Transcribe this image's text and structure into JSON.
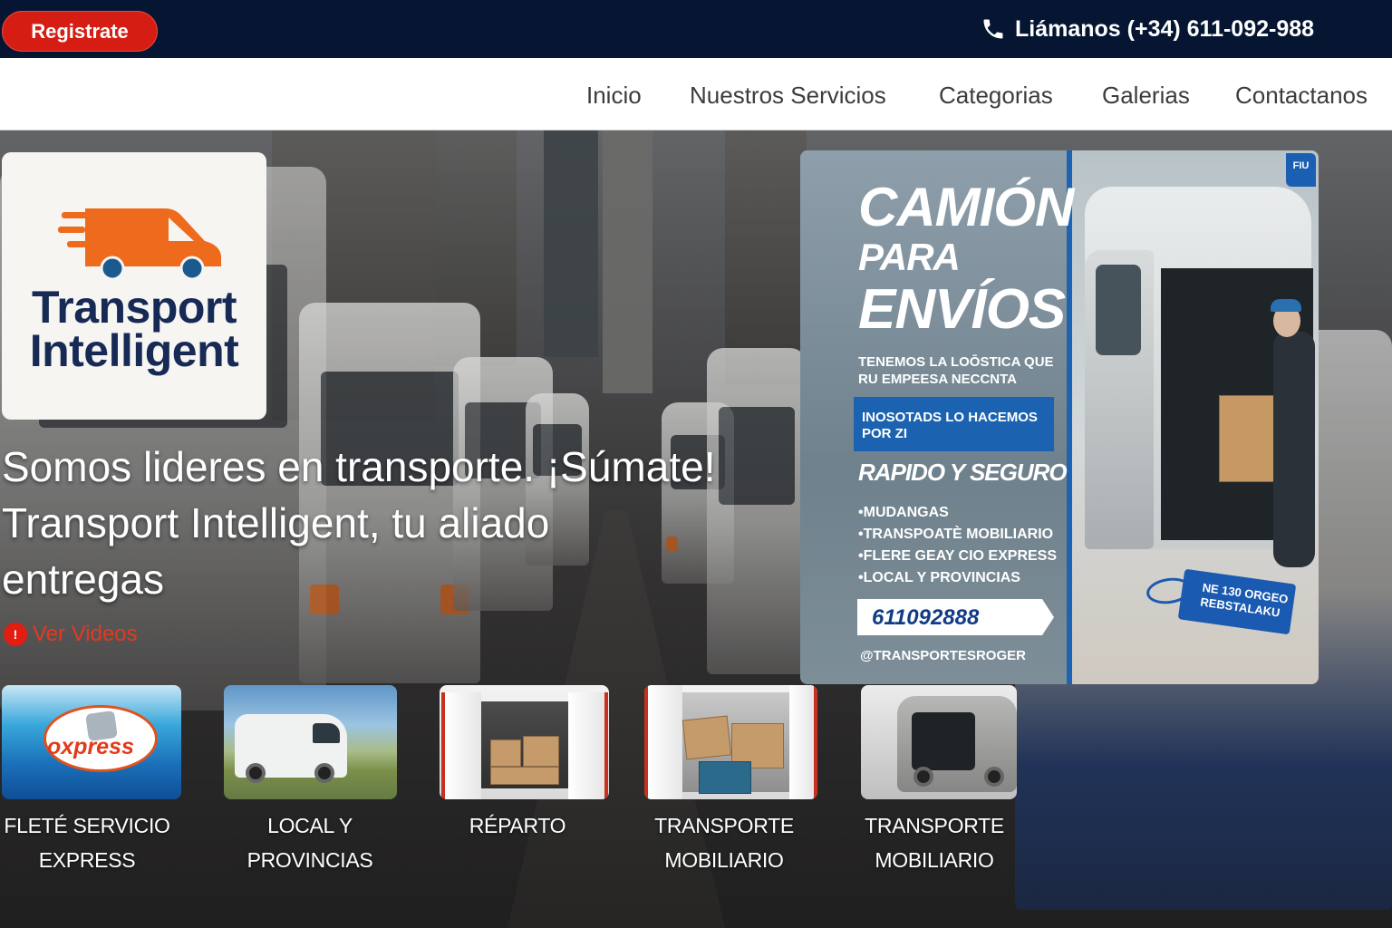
{
  "topbar": {
    "register_label": "Registrate",
    "phone_text": "Liámanos (+34) 611-092-988"
  },
  "nav": {
    "items": [
      "Inicio",
      "Nuestros Servicios",
      "Categorias",
      "Galerias",
      "Contactanos"
    ]
  },
  "hero": {
    "logo_line1": "Transport",
    "logo_line2": "Intelligent",
    "headline_line1": "Somos lideres en transporte. ¡Súmate!",
    "headline_line2": "Transport Intelligent, tu aliado",
    "headline_line3": "entregas",
    "video_link": "Ver Videos"
  },
  "promo": {
    "badge": "FIU",
    "title1": "CAMIÓN",
    "title2": "PARA",
    "title3": "ENVÍOS",
    "sub1": "TENEMOS LA LOŌSTICA QUE",
    "sub2": "RU EMPEESA NECCNTA",
    "blue1": "INOSOTADS LO HACEMOS",
    "blue2": "POR ZI",
    "rapido": "RAPIDO Y SEGURO",
    "list": [
      "MUDANGAS",
      "TRANSPOATÈ MOBILIARIO",
      "FLERE GEAY CIO EXPRESS",
      "LOCAL Y PROVINCIAS"
    ],
    "phone": "611092888",
    "handle": "@TRANSPORTESROGER",
    "tag1": "NE 130 ORGEO",
    "tag2": "REBSTALAKU"
  },
  "services": [
    {
      "line1": "FLETÉ SERVICIO",
      "line2": "EXPRESS",
      "image_word": "oxpress"
    },
    {
      "line1": "LOCAL Y",
      "line2": "PROVINCIAS"
    },
    {
      "line1": "RÉPARTO",
      "line2": ""
    },
    {
      "line1": "TRANSPORTE",
      "line2": "MOBILIARIO"
    },
    {
      "line1": "TRANSPORTE",
      "line2": "MOBILIARIO"
    }
  ],
  "colors": {
    "topbar": "#061632",
    "register": "#d61d13",
    "logo_blue": "#172a55",
    "logo_orange": "#ee6a1c",
    "promo_blue": "#1b63b0"
  },
  "icons": {
    "phone": "phone-icon",
    "video": "alert-circle-icon",
    "logo": "delivery-van-icon"
  }
}
